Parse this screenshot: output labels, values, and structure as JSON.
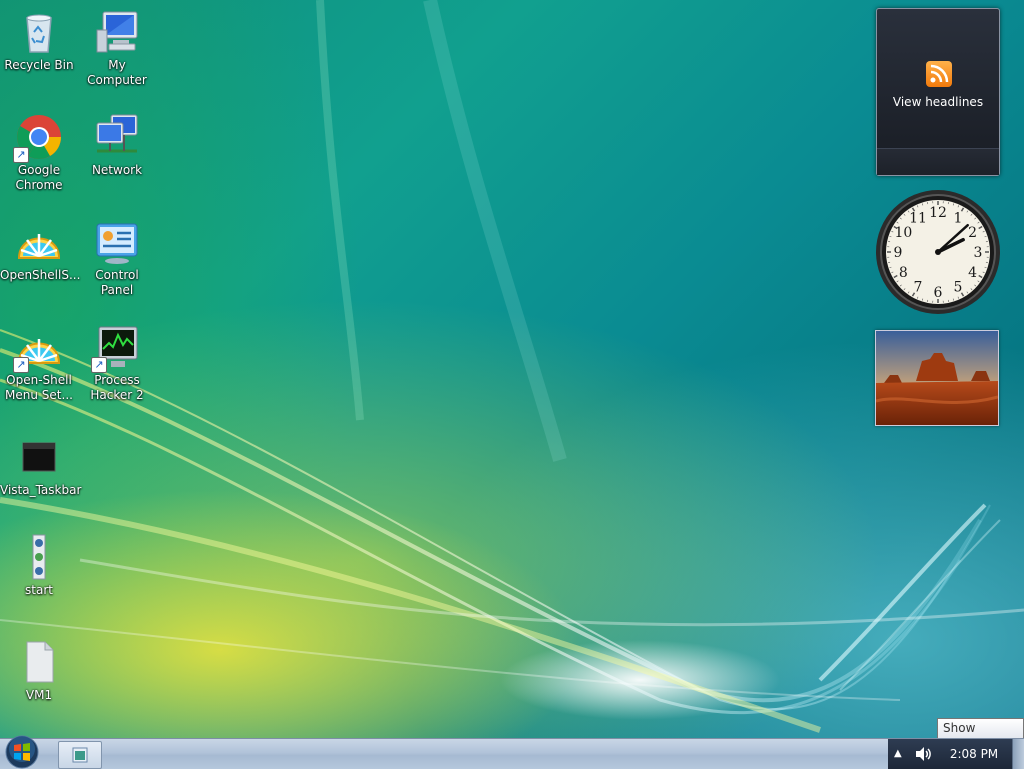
{
  "desktop_icons": [
    {
      "label": "Recycle Bin",
      "icon": "recycle-bin-icon"
    },
    {
      "label": "My Computer",
      "icon": "computer-icon"
    },
    {
      "label": "Google Chrome",
      "icon": "chrome-icon"
    },
    {
      "label": "Network",
      "icon": "network-icon"
    },
    {
      "label": "OpenShellS...",
      "icon": "open-shell-icon"
    },
    {
      "label": "Control Panel",
      "icon": "control-panel-icon"
    },
    {
      "label": "Open-Shell Menu Set...",
      "icon": "open-shell-settings-icon"
    },
    {
      "label": "Process Hacker 2",
      "icon": "process-hacker-icon"
    },
    {
      "label": "Vista_Taskbar",
      "icon": "black-file-icon"
    },
    {
      "label": "start",
      "icon": "batch-file-icon"
    },
    {
      "label": "VM1",
      "icon": "file-icon"
    }
  ],
  "gadgets": {
    "feed": {
      "label": "View headlines",
      "icon": "rss-icon"
    },
    "clock": {
      "numerals": [
        "12",
        "1",
        "2",
        "3",
        "4",
        "5",
        "6",
        "7",
        "8",
        "9",
        "10",
        "11"
      ]
    },
    "slideshow": {
      "icon": "desert-photo"
    }
  },
  "tooltip": {
    "text": "Show desktop"
  },
  "taskbar": {
    "start_icon": "windows-orb-icon",
    "clock": "2:08 PM",
    "tray_icons": [
      "show-hidden-icons-arrow",
      "volume-icon"
    ],
    "tray_arrow": "▲"
  },
  "colors": {
    "taskbar": "#b8c8dc",
    "tray": "#25314a",
    "rss": "#f5830f"
  }
}
